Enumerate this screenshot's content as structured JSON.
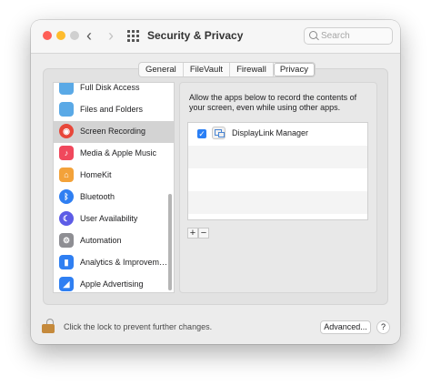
{
  "window": {
    "title": "Security & Privacy",
    "search_placeholder": "Search"
  },
  "nav": {
    "back_glyph": "‹",
    "forward_glyph": "›"
  },
  "tabs": [
    {
      "label": "General",
      "selected": false
    },
    {
      "label": "FileVault",
      "selected": false
    },
    {
      "label": "Firewall",
      "selected": false
    },
    {
      "label": "Privacy",
      "selected": true
    }
  ],
  "sidebar": {
    "items": [
      {
        "label": "Full Disk Access",
        "icon": "folder-icon",
        "color": "#5aa9e6",
        "glyph": ""
      },
      {
        "label": "Files and Folders",
        "icon": "folder-icon",
        "color": "#5aa9e6",
        "glyph": ""
      },
      {
        "label": "Screen Recording",
        "icon": "record-icon",
        "color": "#e8473a",
        "glyph": "◉",
        "selected": true
      },
      {
        "label": "Media & Apple Music",
        "icon": "music-icon",
        "color": "#f0485c",
        "glyph": "♪"
      },
      {
        "label": "HomeKit",
        "icon": "home-icon",
        "color": "#f3a23a",
        "glyph": "⌂"
      },
      {
        "label": "Bluetooth",
        "icon": "bluetooth-icon",
        "color": "#2f7ff2",
        "glyph": "ᛒ"
      },
      {
        "label": "User Availability",
        "icon": "moon-icon",
        "color": "#5d5ce6",
        "glyph": "☾"
      },
      {
        "label": "Automation",
        "icon": "gear-icon",
        "color": "#8e8e93",
        "glyph": "⚙"
      },
      {
        "label": "Analytics & Improvem…",
        "icon": "chart-icon",
        "color": "#2f7ff2",
        "glyph": "▮"
      },
      {
        "label": "Apple Advertising",
        "icon": "megaphone-icon",
        "color": "#2f7ff2",
        "glyph": "◢"
      }
    ]
  },
  "detail": {
    "description": "Allow the apps below to record the contents of your screen, even while using other apps.",
    "apps": [
      {
        "name": "DisplayLink Manager",
        "checked": true
      }
    ],
    "add_label": "+",
    "remove_label": "−"
  },
  "footer": {
    "lock_text": "Click the lock to prevent further changes.",
    "advanced_label": "Advanced...",
    "help_label": "?"
  },
  "colors": {
    "accent": "#2a7ff5",
    "selected_row": "#d3d3d3"
  }
}
